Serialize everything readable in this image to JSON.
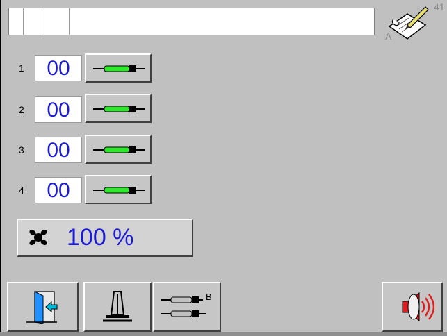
{
  "header": {
    "field_cells": [
      "",
      "",
      ""
    ],
    "notepad_icon": "notepad-pen-icon",
    "notepad_number": "41",
    "notepad_letter": "A"
  },
  "tool_rows": [
    {
      "number": "1",
      "count": "00",
      "icon": "handpiece-icon"
    },
    {
      "number": "2",
      "count": "00",
      "icon": "handpiece-icon"
    },
    {
      "number": "3",
      "count": "00",
      "icon": "handpiece-icon"
    },
    {
      "number": "4",
      "count": "00",
      "icon": "handpiece-icon"
    }
  ],
  "speed": {
    "icon": "star-burst-icon",
    "label": "100 %"
  },
  "toolbar": {
    "exit_icon": "exit-door-icon",
    "chair_icon": "chair-icon",
    "handpiece_b_icon": "handpieces-b-icon",
    "handpiece_b_label": "B",
    "sound_icon": "speaker-icon"
  },
  "colors": {
    "background": "#c0c0c0",
    "value_text": "#1b1bd6",
    "tool_green": "#2ee82e",
    "speaker_red": "#e02020"
  }
}
